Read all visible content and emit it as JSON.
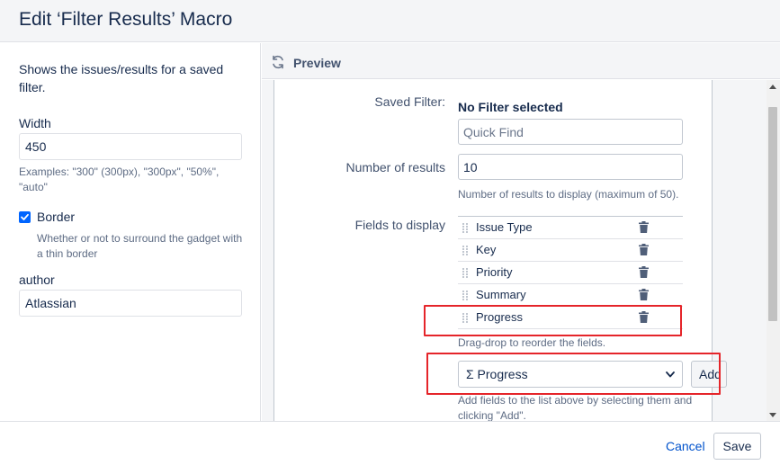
{
  "dialog": {
    "title": "Edit ‘Filter Results’ Macro"
  },
  "left_panel": {
    "description": "Shows the issues/results for a saved filter.",
    "width": {
      "label": "Width",
      "value": "450",
      "hint": "Examples: \"300\" (300px), \"300px\", \"50%\", \"auto\""
    },
    "border": {
      "label": "Border",
      "checked": true,
      "hint": "Whether or not to surround the gadget with a thin border"
    },
    "author": {
      "label": "author",
      "value": "Atlassian"
    }
  },
  "preview": {
    "label": "Preview",
    "saved_filter": {
      "label": "Saved Filter:",
      "value": "No Filter selected",
      "placeholder": "Quick Find"
    },
    "number_of_results": {
      "label": "Number of results",
      "value": "10",
      "hint": "Number of results to display (maximum of 50)."
    },
    "fields_to_display": {
      "label": "Fields to display",
      "fields": [
        {
          "name": "Issue Type"
        },
        {
          "name": "Key"
        },
        {
          "name": "Priority"
        },
        {
          "name": "Summary"
        },
        {
          "name": "Progress"
        }
      ],
      "hint": "Drag-drop to reorder the fields.",
      "select_value": "Σ Progress",
      "add_label": "Add",
      "add_hint": "Add fields to the list above by selecting them and clicking \"Add\"."
    }
  },
  "footer": {
    "cancel_label": "Cancel",
    "save_label": "Save"
  },
  "colors": {
    "accent": "#0052CC",
    "highlight_box": "#E5252A",
    "checkbox": "#0065FF"
  }
}
